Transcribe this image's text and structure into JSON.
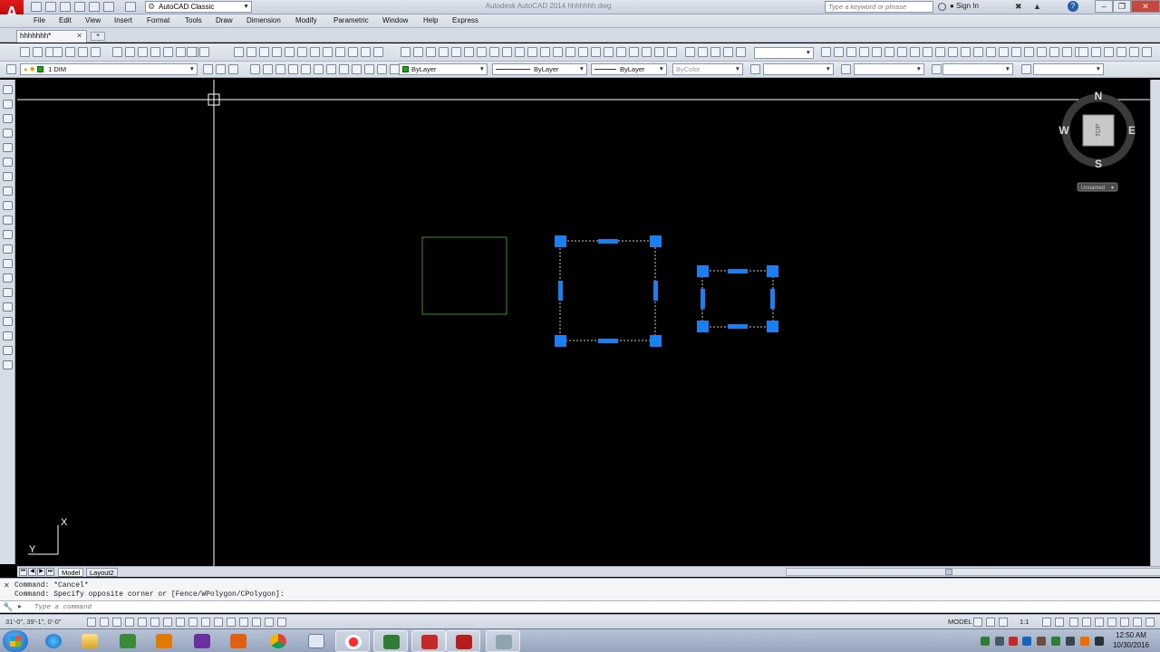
{
  "app": {
    "logo_letter": "A",
    "window_title": "Autodesk AutoCAD 2014    hhhhhhh.dwg",
    "workspace": "AutoCAD Classic",
    "search_placeholder": "Type a keyword or phrase",
    "signin_label": "Sign In",
    "minimize": "–",
    "restore": "❐",
    "close": "✕"
  },
  "menu": [
    "File",
    "Edit",
    "View",
    "Insert",
    "Format",
    "Tools",
    "Draw",
    "Dimension",
    "Modify",
    "Parametric",
    "Window",
    "Help",
    "Express"
  ],
  "document_tab": {
    "label": "hhhhhhh*",
    "close": "✕",
    "new_tab": "+"
  },
  "layer_toolbar": {
    "current_layer": "1 DIM",
    "color": "ByLayer",
    "linetype": "ByLayer",
    "lineweight": "ByLayer",
    "plot_style": "ByColor"
  },
  "viewcube": {
    "north": "N",
    "south": "S",
    "east": "E",
    "west": "W",
    "face": "TOP",
    "ucs_menu": "Unnamed"
  },
  "ucs_icon": {
    "x_label": "X",
    "y_label": "Y"
  },
  "layout_tabs": [
    "Model",
    "Layout2"
  ],
  "command_history": [
    "Command: *Cancel*",
    "Command: Specify opposite corner or [Fence/WPolygon/CPolygon]:"
  ],
  "command_input_placeholder": "Type a command",
  "status": {
    "coordinates": "31'-0\",  39'-1\",  0'-0\"",
    "space": "MODEL",
    "annotation_scale": "1:1"
  },
  "clock": {
    "time": "12:50 AM",
    "date": "10/30/2016"
  },
  "colors": {
    "grip": "#1c7ff0",
    "rectangle": "#3f8f2a",
    "canvas": "#000000",
    "crosshair": "#ffffff"
  }
}
